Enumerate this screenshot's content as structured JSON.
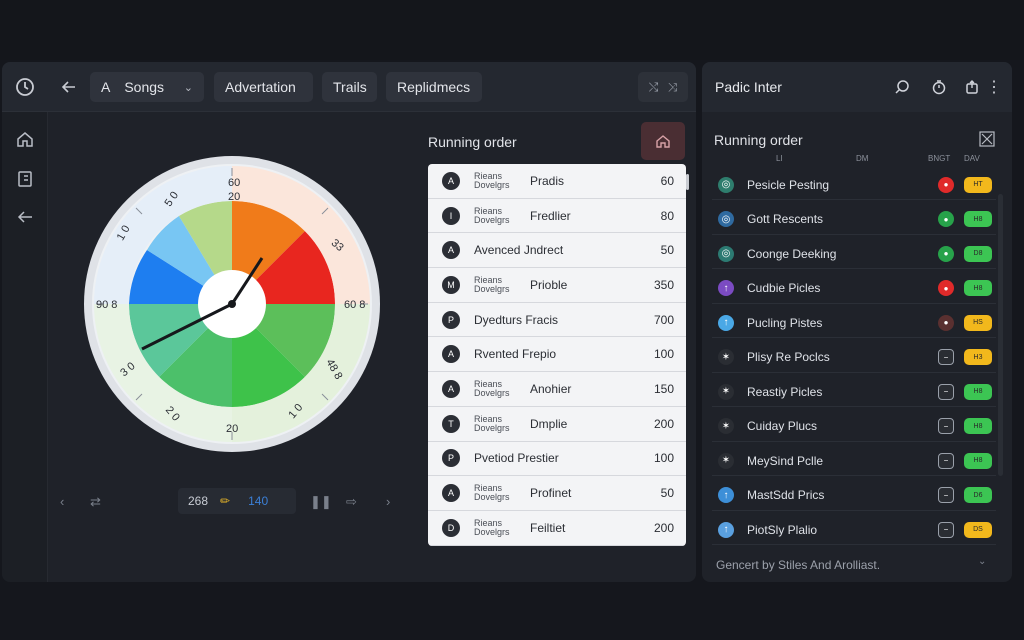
{
  "toolbar": {
    "songs_letter": "A",
    "songs_label": "Songs",
    "tabs": [
      "Advertation",
      "Trails",
      "Replidmecs"
    ]
  },
  "wheel": {
    "labels": [
      "60",
      "20",
      "5 0",
      "1 0",
      "33",
      "90 8",
      "60 8",
      "3 0",
      "48 8",
      "2 0",
      "20",
      "1 0"
    ]
  },
  "controls": {
    "field_value": "268",
    "field_secondary": "140"
  },
  "running_order": {
    "title": "Running order",
    "rows": [
      {
        "badge": "A",
        "sub": "Rieans Dovelgrs",
        "name": "Pradis",
        "value": "60"
      },
      {
        "badge": "I",
        "sub": "Rieans Dovelgrs",
        "name": "Fredlier",
        "value": "80"
      },
      {
        "badge": "A",
        "sub": "",
        "name": "Avenced  Jndrect",
        "value": "50"
      },
      {
        "badge": "M",
        "sub": "Rieans Dovelgrs",
        "name": "Prioble",
        "value": "350"
      },
      {
        "badge": "P",
        "sub": "",
        "name": "Dyedturs  Fracis",
        "value": "700"
      },
      {
        "badge": "A",
        "sub": "",
        "name": "Rvented  Frepio",
        "value": "100"
      },
      {
        "badge": "A",
        "sub": "Rieans Dovelgrs",
        "name": "Anohier",
        "value": "150"
      },
      {
        "badge": "T",
        "sub": "Rieans Dovelgrs",
        "name": "Dmplie",
        "value": "200"
      },
      {
        "badge": "P",
        "sub": "",
        "name": "Pvetiod  Prestier",
        "value": "100"
      },
      {
        "badge": "A",
        "sub": "Rieans Dovelgrs",
        "name": "Profinet",
        "value": "50"
      },
      {
        "badge": "D",
        "sub": "Rieans Dovelgrs",
        "name": "Feiltiet",
        "value": "200"
      }
    ]
  },
  "side": {
    "title": "Padic Inter",
    "subtitle": "Running order",
    "col_heads": [
      "LI",
      "DM",
      "BNGT",
      "DAV"
    ],
    "rows": [
      {
        "name": "Pesicle Pesting",
        "icon_color": "#2e7d6d",
        "dot_color": "#e02a2a",
        "pill_color": "#f2b81c",
        "pill_text": "HT"
      },
      {
        "name": "Gott Rescents",
        "icon_color": "#2f6aa0",
        "dot_color": "#27a24a",
        "pill_color": "#3cc553",
        "pill_text": "H8"
      },
      {
        "name": "Coonge Deeking",
        "icon_color": "#2c7a72",
        "dot_color": "#27a24a",
        "pill_color": "#3cc553",
        "pill_text": "D8"
      },
      {
        "name": "Cudbie Picles",
        "icon_color": "#7b4bc2",
        "dot_color": "#e02a2a",
        "pill_color": "#3cc553",
        "pill_text": "H8"
      },
      {
        "name": "Pucling Pistes",
        "icon_color": "#4aa8e6",
        "dot_color": "#5a3030",
        "pill_color": "#f2b81c",
        "pill_text": "HS"
      },
      {
        "name": "Plisy Re Poclcs",
        "icon_color": "#2a2d33",
        "dot_color": "#2a2d33",
        "pill_color": "#f2b81c",
        "pill_text": "H3"
      },
      {
        "name": "Reastiy Picles",
        "icon_color": "#2a2d33",
        "dot_color": "#2a2d33",
        "pill_color": "#3cc553",
        "pill_text": "H8"
      },
      {
        "name": "Cuiday Plucs",
        "icon_color": "#2a2d33",
        "dot_color": "#2a2d33",
        "pill_color": "#3cc553",
        "pill_text": "H8"
      },
      {
        "name": "MeySind Pclle",
        "icon_color": "#2a2d33",
        "dot_color": "#2a2d33",
        "pill_color": "#3cc553",
        "pill_text": "H8"
      },
      {
        "name": "MastSdd Prics",
        "icon_color": "#3d8fd8",
        "dot_color": "#2a2d33",
        "pill_color": "#3cc553",
        "pill_text": "D6"
      },
      {
        "name": "PiotSly Plalio",
        "icon_color": "#5aa0e0",
        "dot_color": "#2a2d33",
        "pill_color": "#f2b81c",
        "pill_text": "DS"
      }
    ],
    "footer": "Gencert by Stiles And Arolliast."
  }
}
